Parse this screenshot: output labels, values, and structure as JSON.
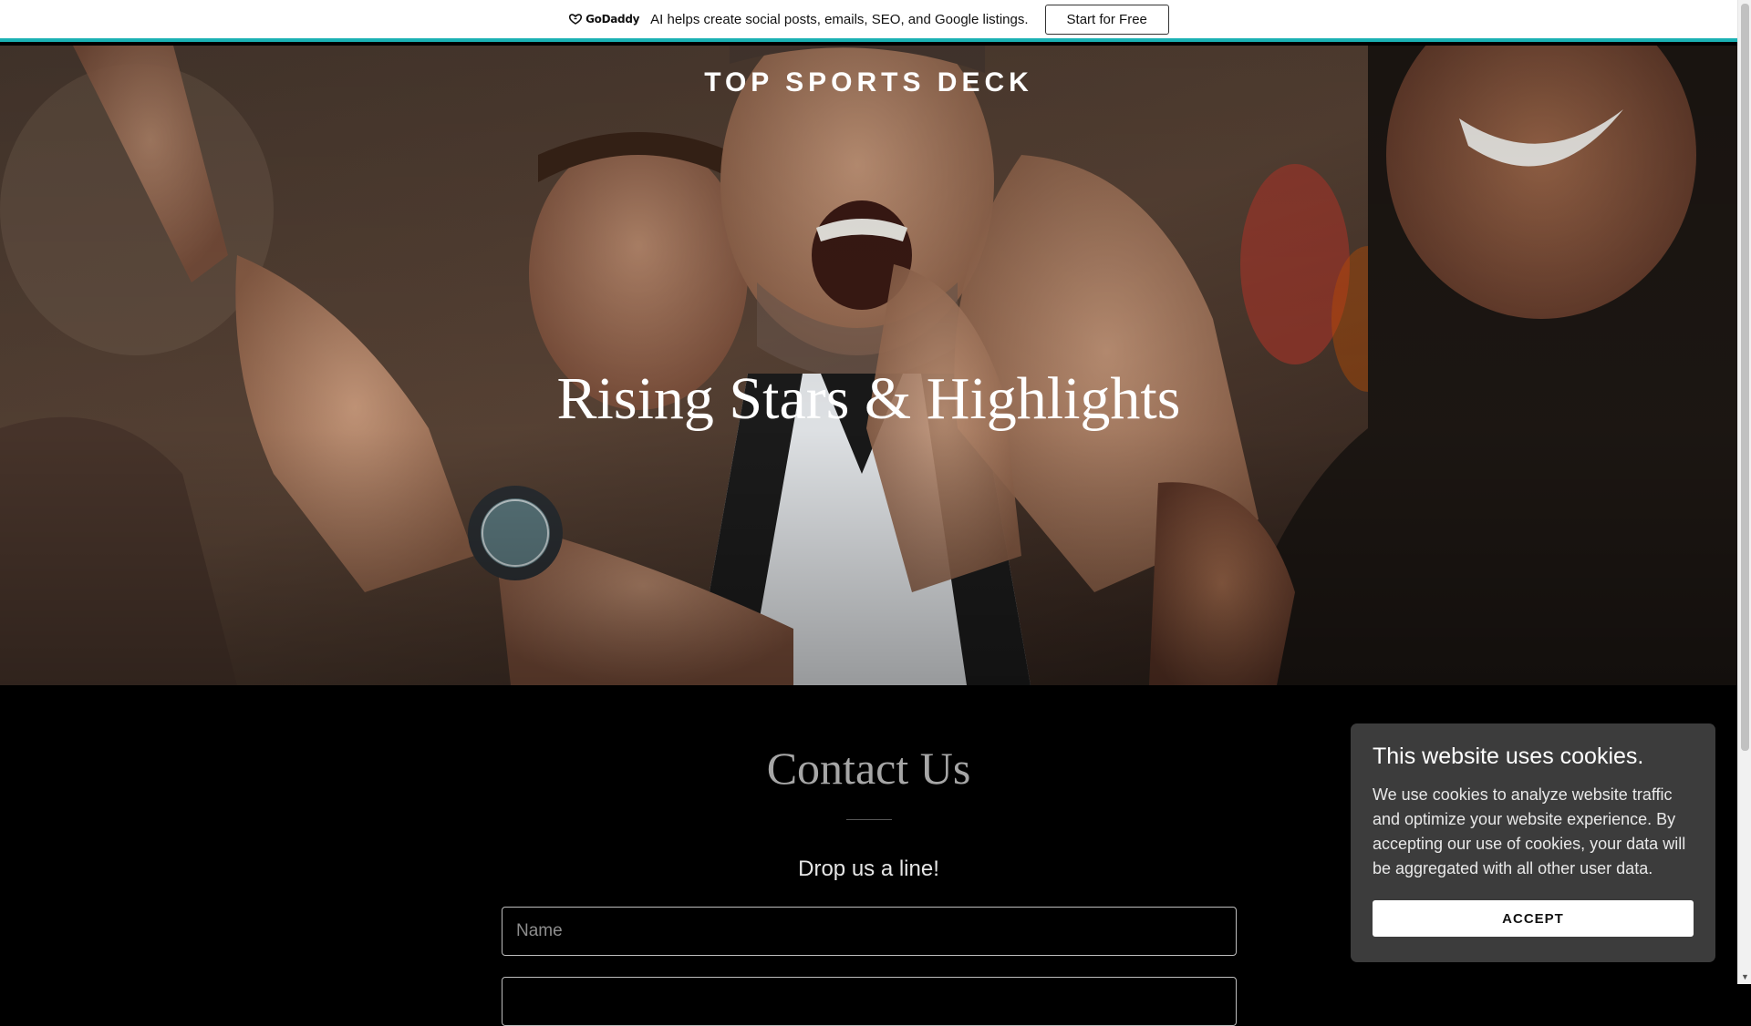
{
  "promo": {
    "logo_text": "GoDaddy",
    "text": "AI helps create social posts, emails, SEO, and Google listings.",
    "button_label": "Start for Free",
    "accent_color": "#1bb1b4"
  },
  "hero": {
    "site_title": "TOP SPORTS DECK",
    "heading": "Rising Stars & Highlights"
  },
  "contact": {
    "title": "Contact Us",
    "subtitle": "Drop us a line!",
    "name_placeholder": "Name",
    "email_placeholder": ""
  },
  "cookies": {
    "title": "This website uses cookies.",
    "body": "We use cookies to analyze website traffic and optimize your website experience. By accepting our use of cookies, your data will be aggregated with all other user data.",
    "accept_label": "ACCEPT"
  },
  "icons": {
    "logo": "godaddy-logo-icon",
    "scroll_down": "scroll-down-arrow-icon"
  }
}
